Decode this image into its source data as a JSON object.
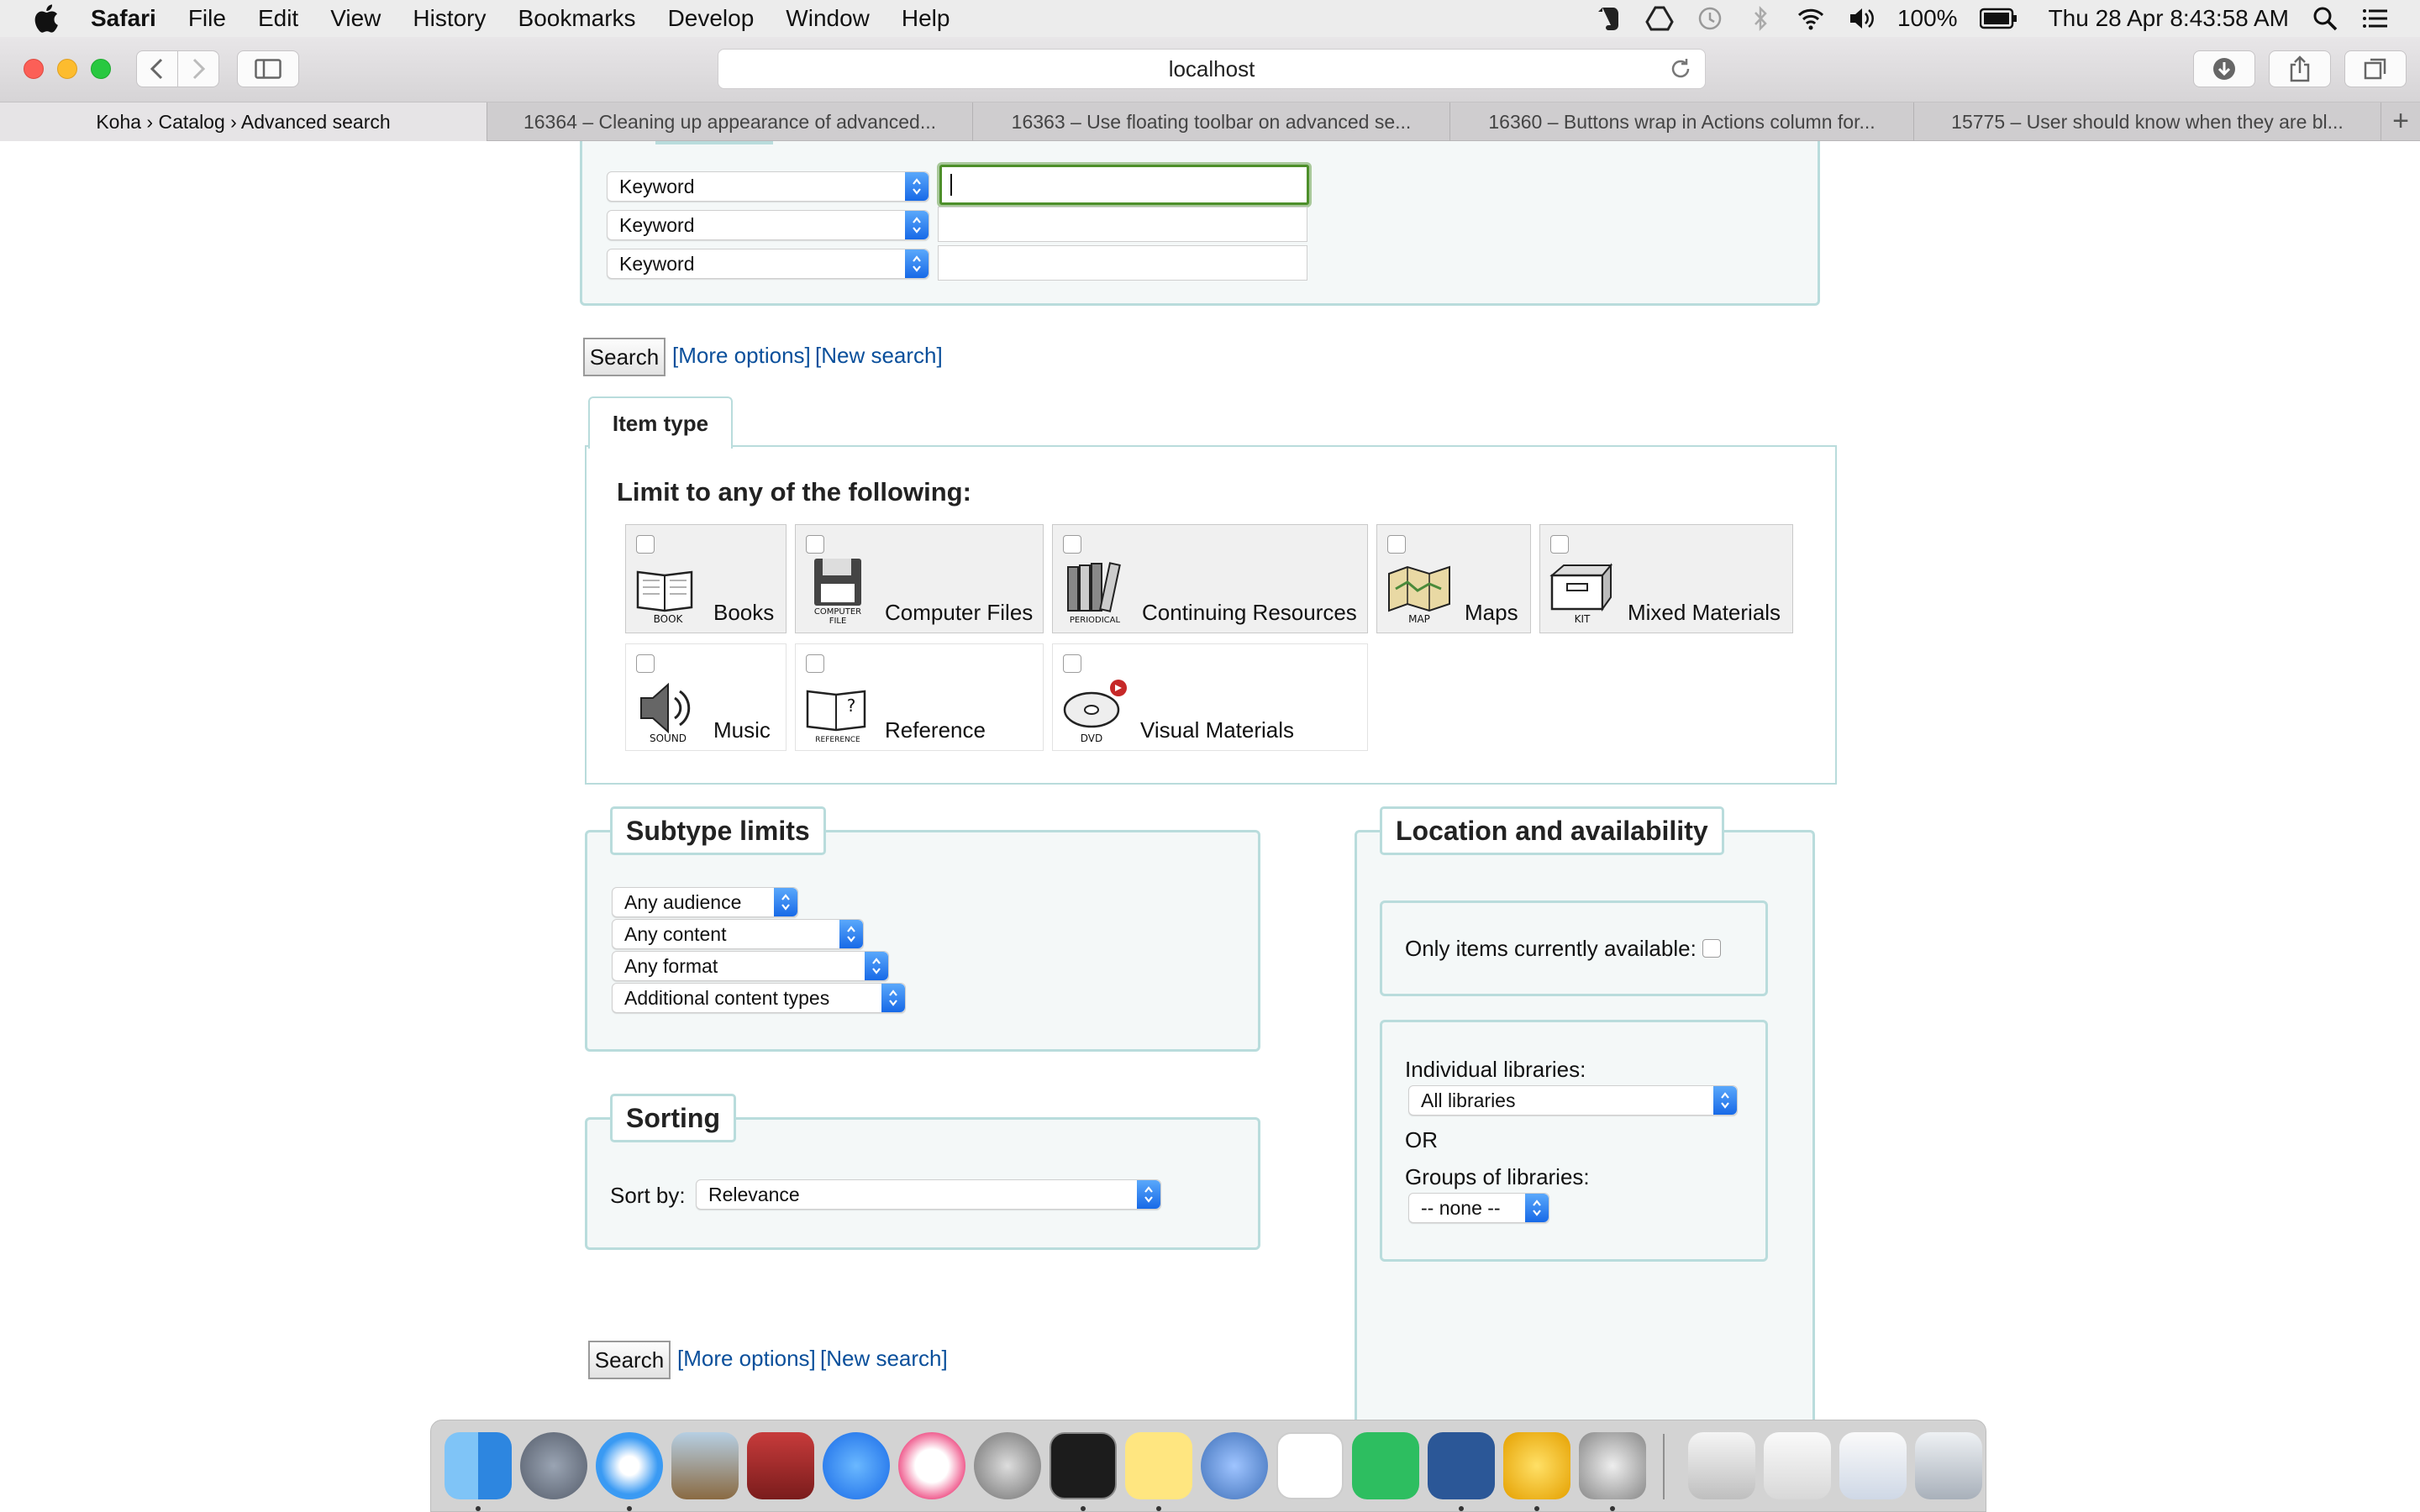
{
  "menubar": {
    "app_name": "Safari",
    "menus": [
      "File",
      "Edit",
      "View",
      "History",
      "Bookmarks",
      "Develop",
      "Window",
      "Help"
    ],
    "battery": "100%",
    "clock": "Thu 28 Apr  8:43:58 AM"
  },
  "browser": {
    "address": "localhost",
    "tabs": [
      {
        "label": "Koha › Catalog › Advanced search",
        "active": true
      },
      {
        "label": "16364 – Cleaning up appearance of advanced...",
        "active": false
      },
      {
        "label": "16363 – Use floating toolbar on advanced se...",
        "active": false
      },
      {
        "label": "16360 – Buttons wrap in Actions column for...",
        "active": false
      },
      {
        "label": "15775 – User should know when they are bl...",
        "active": false
      }
    ],
    "new_tab": "+"
  },
  "search": {
    "rows": [
      {
        "index": "Keyword",
        "value": ""
      },
      {
        "index": "Keyword",
        "value": ""
      },
      {
        "index": "Keyword",
        "value": ""
      }
    ],
    "search_label": "Search",
    "more_options": "[More options]",
    "new_search": "[New search]"
  },
  "item_type": {
    "tab_label": "Item type",
    "heading": "Limit to any of the following:",
    "types": [
      {
        "name": "Books",
        "icon_caption": "BOOK",
        "icon": "book-icon"
      },
      {
        "name": "Computer Files",
        "icon_caption": "COMPUTER FILE",
        "icon": "floppy-disk-icon"
      },
      {
        "name": "Continuing Resources",
        "icon_caption": "PERIODICAL",
        "icon": "periodical-icon"
      },
      {
        "name": "Maps",
        "icon_caption": "MAP",
        "icon": "map-icon"
      },
      {
        "name": "Mixed Materials",
        "icon_caption": "KIT",
        "icon": "kit-box-icon"
      },
      {
        "name": "Music",
        "icon_caption": "SOUND",
        "icon": "speaker-icon"
      },
      {
        "name": "Reference",
        "icon_caption": "REFERENCE",
        "icon": "reference-book-icon"
      },
      {
        "name": "Visual Materials",
        "icon_caption": "DVD",
        "icon": "dvd-icon"
      }
    ]
  },
  "subtype": {
    "legend": "Subtype limits",
    "audience": "Any audience",
    "content": "Any content",
    "format": "Any format",
    "additional": "Additional content types"
  },
  "sorting": {
    "legend": "Sorting",
    "sort_by_label": "Sort by:",
    "sort_by_value": "Relevance"
  },
  "location": {
    "legend": "Location and availability",
    "available_label": "Only items currently available:",
    "libraries_label": "Individual libraries:",
    "libraries_value": "All libraries",
    "or_label": "OR",
    "groups_label": "Groups of libraries:",
    "groups_value": "-- none --"
  },
  "colors": {
    "fieldset_border": "#b9dcdc",
    "fieldset_bg": "#f4f8f8",
    "link": "#0a4f9b",
    "focus": "#4d8f2a"
  }
}
